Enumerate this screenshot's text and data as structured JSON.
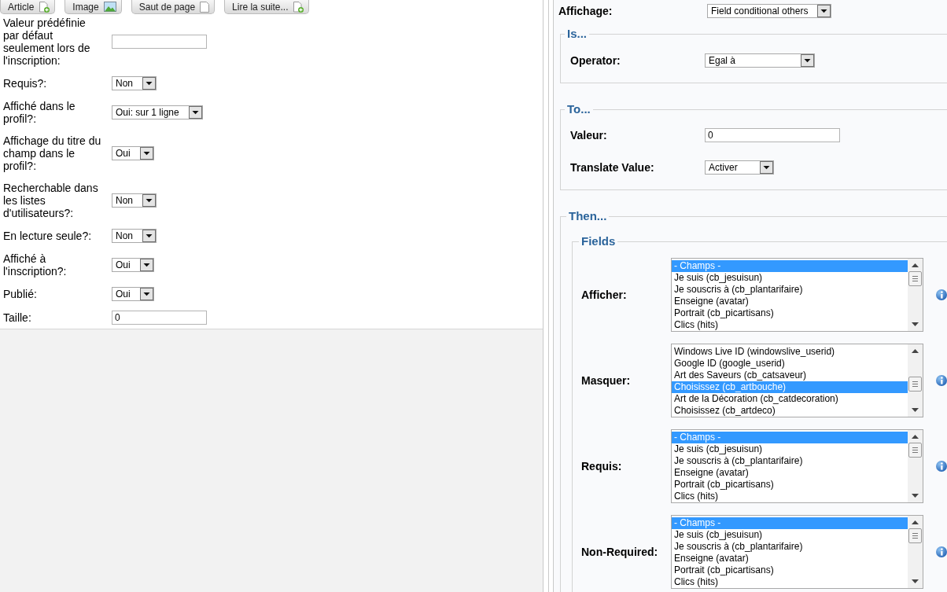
{
  "toolbar": {
    "buttons": [
      {
        "label": "Article",
        "kind": "add"
      },
      {
        "label": "Image",
        "kind": "image"
      },
      {
        "label": "Saut de page",
        "kind": "page"
      },
      {
        "label": "Lire la suite...",
        "kind": "add"
      }
    ]
  },
  "field_form": {
    "rows": [
      {
        "label": "Valeur prédéfinie par défaut seulement lors de l'inscription:",
        "kind": "text"
      },
      {
        "label": "Requis?:",
        "kind": "select",
        "value": "Non"
      },
      {
        "label": "Affiché dans le profil?:",
        "kind": "select",
        "value": "Oui: sur 1 ligne"
      },
      {
        "label": "Affichage du titre du champ dans le profil?:",
        "kind": "select",
        "value": "Oui"
      },
      {
        "label": "Recherchable dans les listes d'utilisateurs?:",
        "kind": "select",
        "value": "Non"
      },
      {
        "label": "En lecture seule?:",
        "kind": "select",
        "value": "Non"
      },
      {
        "label": "Affiché à l'inscription?:",
        "kind": "select",
        "value": "Oui"
      },
      {
        "label": "Publié:",
        "kind": "select",
        "value": "Oui"
      },
      {
        "label": "Taille:",
        "kind": "text",
        "value": "0"
      }
    ]
  },
  "conditional": {
    "display": {
      "label": "Affichage:",
      "value": "Field conditional others"
    },
    "is": {
      "legend": "Is...",
      "rows": [
        {
          "label": "Operator:",
          "kind": "select",
          "value": "Egal à"
        }
      ]
    },
    "to": {
      "legend": "To...",
      "rows": [
        {
          "label": "Valeur:",
          "kind": "text",
          "value": "0"
        },
        {
          "label": "Translate Value:",
          "kind": "select",
          "value": "Activer"
        }
      ]
    },
    "then": {
      "legend": "Then...",
      "fields": {
        "legend": "Fields",
        "rows": [
          {
            "label": "Afficher:",
            "options": [
              {
                "label": "- Champs -",
                "selected": true
              },
              {
                "label": "Je suis (cb_jesuisun)",
                "selected": false
              },
              {
                "label": "Je souscris à (cb_plantarifaire)",
                "selected": false
              },
              {
                "label": "Enseigne (avatar)",
                "selected": false
              },
              {
                "label": "Portrait (cb_picartisans)",
                "selected": false
              },
              {
                "label": "Clics (hits)",
                "selected": false
              }
            ]
          },
          {
            "label": "Masquer:",
            "options": [
              {
                "label": "Windows Live ID (windowslive_userid)",
                "selected": false
              },
              {
                "label": "Google ID (google_userid)",
                "selected": false
              },
              {
                "label": "Art des Saveurs (cb_catsaveur)",
                "selected": false
              },
              {
                "label": "Choisissez (cb_artbouche)",
                "selected": true
              },
              {
                "label": "Art de la Décoration (cb_catdecoration)",
                "selected": false
              },
              {
                "label": "Choisissez (cb_artdeco)",
                "selected": false
              }
            ]
          },
          {
            "label": "Requis:",
            "options": [
              {
                "label": "- Champs -",
                "selected": true
              },
              {
                "label": "Je suis (cb_jesuisun)",
                "selected": false
              },
              {
                "label": "Je souscris à (cb_plantarifaire)",
                "selected": false
              },
              {
                "label": "Enseigne (avatar)",
                "selected": false
              },
              {
                "label": "Portrait (cb_picartisans)",
                "selected": false
              },
              {
                "label": "Clics (hits)",
                "selected": false
              }
            ]
          },
          {
            "label": "Non-Required:",
            "options": [
              {
                "label": "- Champs -",
                "selected": true
              },
              {
                "label": "Je suis (cb_jesuisun)",
                "selected": false
              },
              {
                "label": "Je souscris à (cb_plantarifaire)",
                "selected": false
              },
              {
                "label": "Enseigne (avatar)",
                "selected": false
              },
              {
                "label": "Portrait (cb_picartisans)",
                "selected": false
              },
              {
                "label": "Clics (hits)",
                "selected": false
              }
            ]
          }
        ]
      }
    }
  }
}
